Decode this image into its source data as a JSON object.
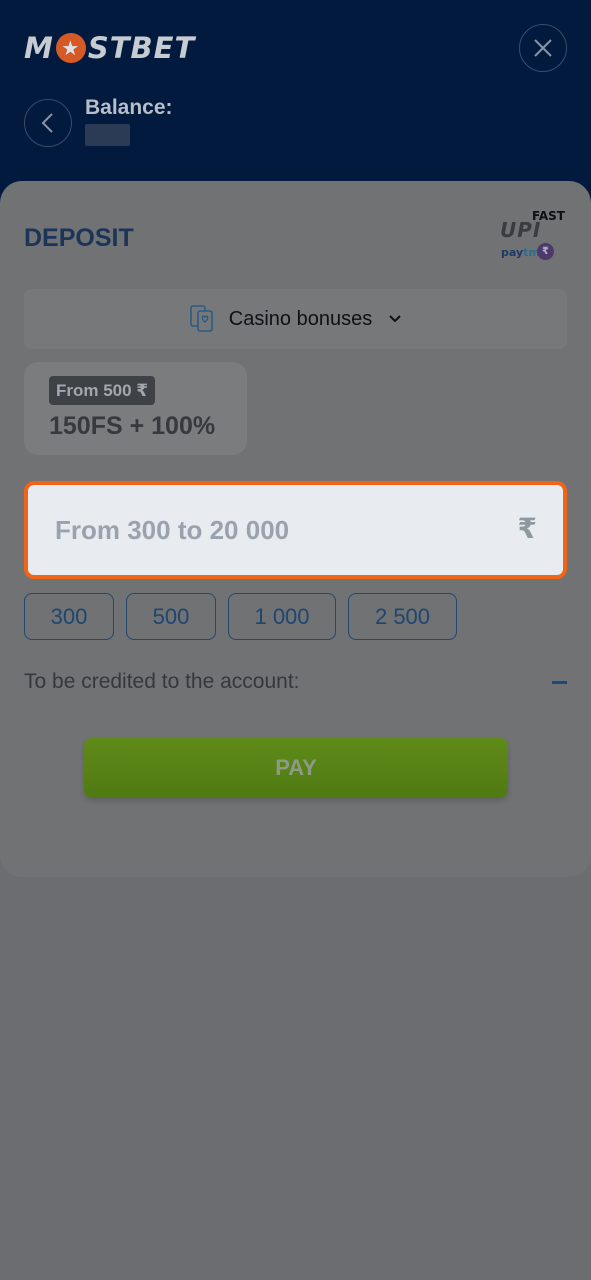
{
  "header": {
    "logo_left": "M",
    "logo_star": "★",
    "logo_right": "STBET",
    "balance_label": "Balance:"
  },
  "deposit": {
    "title": "DEPOSIT",
    "payment_logos": {
      "upi": "UPI",
      "fast": "FAST",
      "paytm_a": "pay",
      "paytm_b": "tm"
    }
  },
  "bonus_select": {
    "label": "Casino bonuses"
  },
  "bonus_card": {
    "badge": "From 500 ₹",
    "amount": "150FS + 100%"
  },
  "amount_input": {
    "placeholder": "From 300 to 20 000",
    "value": "",
    "currency": "₹"
  },
  "quick_amounts": [
    "300",
    "500",
    "1 000",
    "2 500"
  ],
  "credited": {
    "label": "To be credited to the account:",
    "value": "–"
  },
  "pay_button": {
    "label": "PAY"
  },
  "colors": {
    "header_bg": "#021a3d",
    "accent_orange": "#f06418",
    "pay_green": "#5a8617",
    "title_navy": "#1b3457"
  }
}
